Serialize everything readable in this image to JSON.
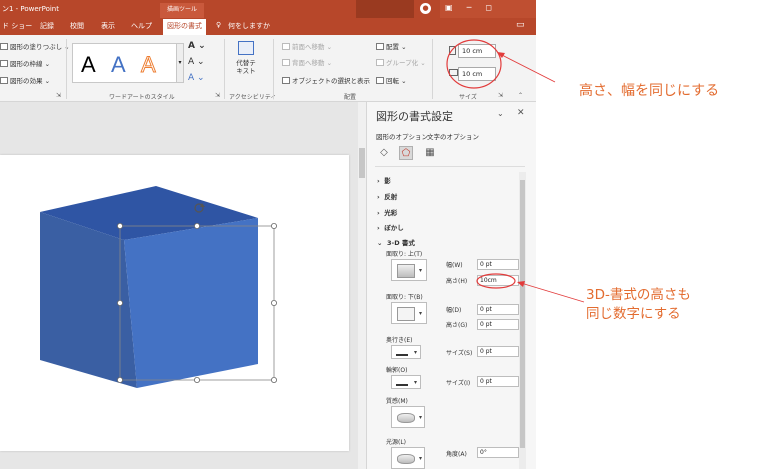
{
  "app": {
    "title": "ン1  -  PowerPoint",
    "drawing_tools_label": "描画ツール",
    "user_icon": "user-icon"
  },
  "tabs": [
    {
      "label": "ド ショー"
    },
    {
      "label": "記録"
    },
    {
      "label": "校閲"
    },
    {
      "label": "表示"
    },
    {
      "label": "ヘルプ"
    },
    {
      "label": "図形の書式"
    },
    {
      "label": "何をしますか"
    }
  ],
  "ribbon": {
    "shape_fill": "図形の塗りつぶし",
    "shape_outline": "図形の枠線",
    "shape_effects": "図形の効果",
    "wordart_samples": [
      "A",
      "A",
      "A"
    ],
    "wordart_group": "ワードアートのスタイル",
    "alt_text": "代替テキスト",
    "accessibility_group": "アクセシビリティ",
    "bring_forward": "前面へ移動",
    "send_backward": "背面へ移動",
    "selection_pane": "オブジェクトの選択と表示",
    "align": "配置",
    "group": "グループ化",
    "rotate": "回転",
    "arrange_group": "配置",
    "height_value": "10 cm",
    "width_value": "10 cm",
    "size_group": "サイズ"
  },
  "pane": {
    "title": "図形の書式設定",
    "tabs": [
      "図形のオプション",
      "文字のオプション"
    ],
    "sections": [
      "影",
      "反射",
      "光彩",
      "ぼかし",
      "3-D 書式"
    ],
    "bevel_top": "面取り: 上(T)",
    "bevel_bottom": "面取り: 下(B)",
    "width_label": "幅(W)",
    "height_label": "高さ(H)",
    "width_label_2": "幅(D)",
    "height_label_2": "高さ(G)",
    "top_width": "0 pt",
    "top_height": "10cm",
    "bottom_width": "0 pt",
    "bottom_height": "0 pt",
    "depth": "奥行き(E)",
    "contour": "輪郭(O)",
    "size_label": "サイズ(S)",
    "size_label_2": "サイズ(I)",
    "depth_size": "0 pt",
    "contour_size": "0 pt",
    "material": "質感(M)",
    "lighting": "光源(L)",
    "angle_label": "角度(A)",
    "angle_value": "0°"
  },
  "annotations": {
    "note1": "高さ、幅を同じにする",
    "note2_line1": "3D-書式の高さも",
    "note2_line2": "同じ数字にする",
    "color": "#e36c30"
  },
  "colors": {
    "accent": "#b7472a",
    "cube_front": "#4472c4",
    "cube_side": "#3a5fa3",
    "cube_top": "#2f55a4"
  }
}
